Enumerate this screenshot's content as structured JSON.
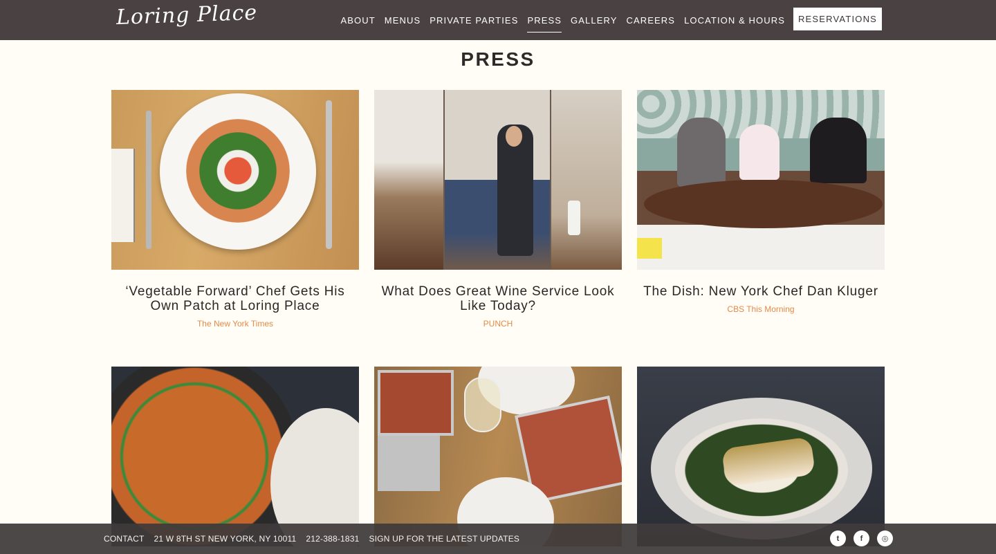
{
  "header": {
    "logo": "Loring Place",
    "nav": [
      "ABOUT",
      "MENUS",
      "PRIVATE PARTIES",
      "PRESS",
      "GALLERY",
      "CAREERS",
      "LOCATION & HOURS"
    ],
    "active_nav": "PRESS",
    "reservations_label": "RESERVATIONS"
  },
  "page": {
    "title": "PRESS"
  },
  "articles": [
    {
      "headline": "‘Vegetable Forward’ Chef Gets His Own Patch at Loring Place",
      "source": "The New York Times"
    },
    {
      "headline": "What Does Great Wine Service Look Like Today?",
      "source": "PUNCH"
    },
    {
      "headline": "The Dish: New York Chef Dan Kluger",
      "source": "CBS This Morning"
    },
    {
      "headline": "",
      "source": ""
    },
    {
      "headline": "",
      "source": ""
    },
    {
      "headline": "",
      "source": ""
    }
  ],
  "footer": {
    "links": [
      "CONTACT",
      "21 W 8TH ST NEW YORK, NY 10011",
      "212-388-1831",
      "SIGN UP FOR THE LATEST UPDATES"
    ],
    "social": [
      {
        "icon": "twitter-icon",
        "glyph": "t"
      },
      {
        "icon": "facebook-icon",
        "glyph": "f"
      },
      {
        "icon": "instagram-icon",
        "glyph": "◎"
      }
    ]
  },
  "colors": {
    "header_bg": "#4a4242",
    "page_bg": "#fffdf5",
    "source_accent": "#e48a48"
  }
}
